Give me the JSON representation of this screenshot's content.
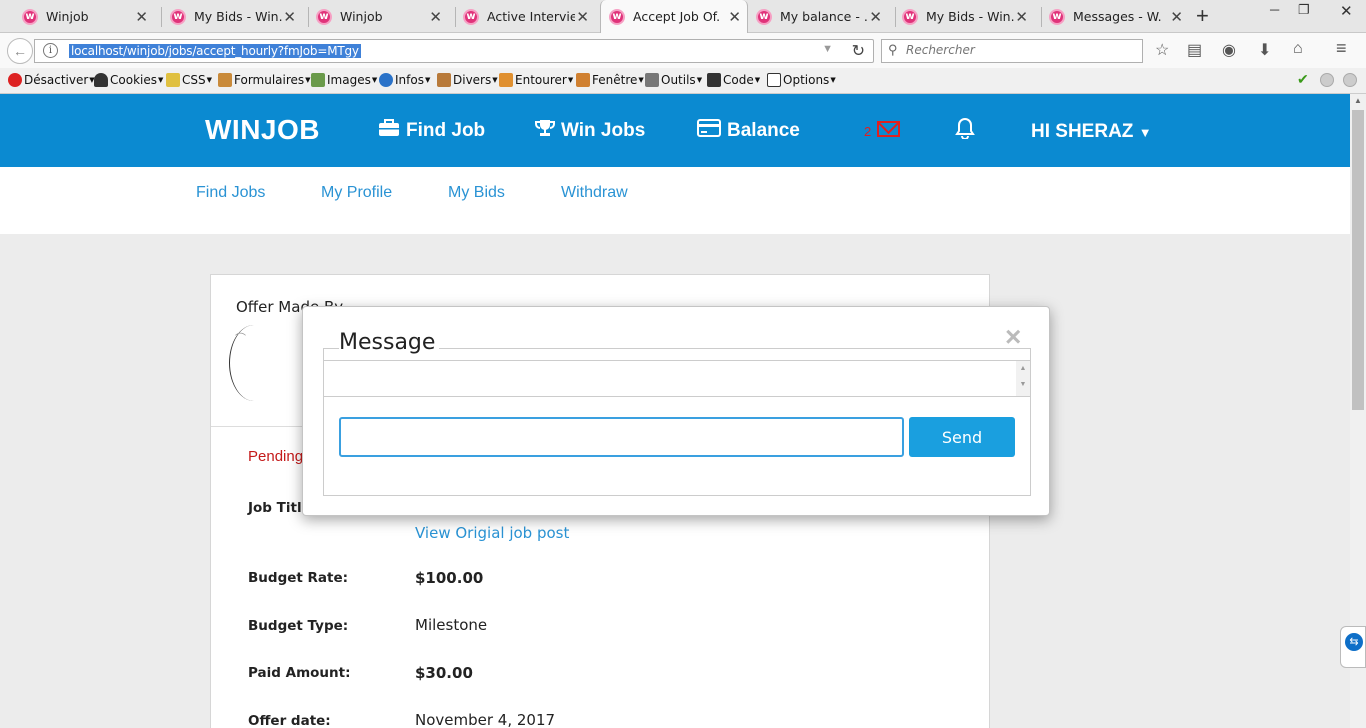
{
  "browser": {
    "tabs": [
      {
        "title": "Winjob"
      },
      {
        "title": "My Bids - Win..."
      },
      {
        "title": "Winjob"
      },
      {
        "title": "Active Intervie..."
      },
      {
        "title": "Accept Job Of...",
        "active": true
      },
      {
        "title": "My balance - ..."
      },
      {
        "title": "My Bids - Win..."
      },
      {
        "title": "Messages - W..."
      }
    ],
    "url": "localhost/winjob/jobs/accept_hourly?fmJob=MTgy",
    "search_placeholder": "Rechercher",
    "webdev_toolbar": [
      "Désactiver",
      "Cookies",
      "CSS",
      "Formulaires",
      "Images",
      "Infos",
      "Divers",
      "Entourer",
      "Fenêtre",
      "Outils",
      "Code",
      "Options"
    ]
  },
  "site": {
    "logo": "WINJOB",
    "nav": {
      "find_job": "Find Job",
      "win_jobs": "Win Jobs",
      "balance": "Balance",
      "message_count": "2",
      "user": "HI SHERAZ"
    },
    "subnav": [
      "Find Jobs",
      "My Profile",
      "My Bids",
      "Withdraw"
    ],
    "colors": {
      "header": "#0b8ad1",
      "link": "#2a93d4",
      "pending": "#c41a1a",
      "send": "#1a9fdf"
    }
  },
  "offer": {
    "made_by_label": "Offer Made By",
    "status": "Pending",
    "job_title_label": "Job Title",
    "view_job_link": "View Origial job post",
    "rows": [
      {
        "label": "Budget Rate:",
        "value": "$100.00"
      },
      {
        "label": "Budget Type:",
        "value": "Milestone"
      },
      {
        "label": "Paid Amount:",
        "value": "$30.00"
      },
      {
        "label": "Offer date:",
        "value": "November 4, 2017"
      }
    ]
  },
  "modal": {
    "title": "Message",
    "close": "×",
    "input_value": "",
    "send_label": "Send"
  }
}
